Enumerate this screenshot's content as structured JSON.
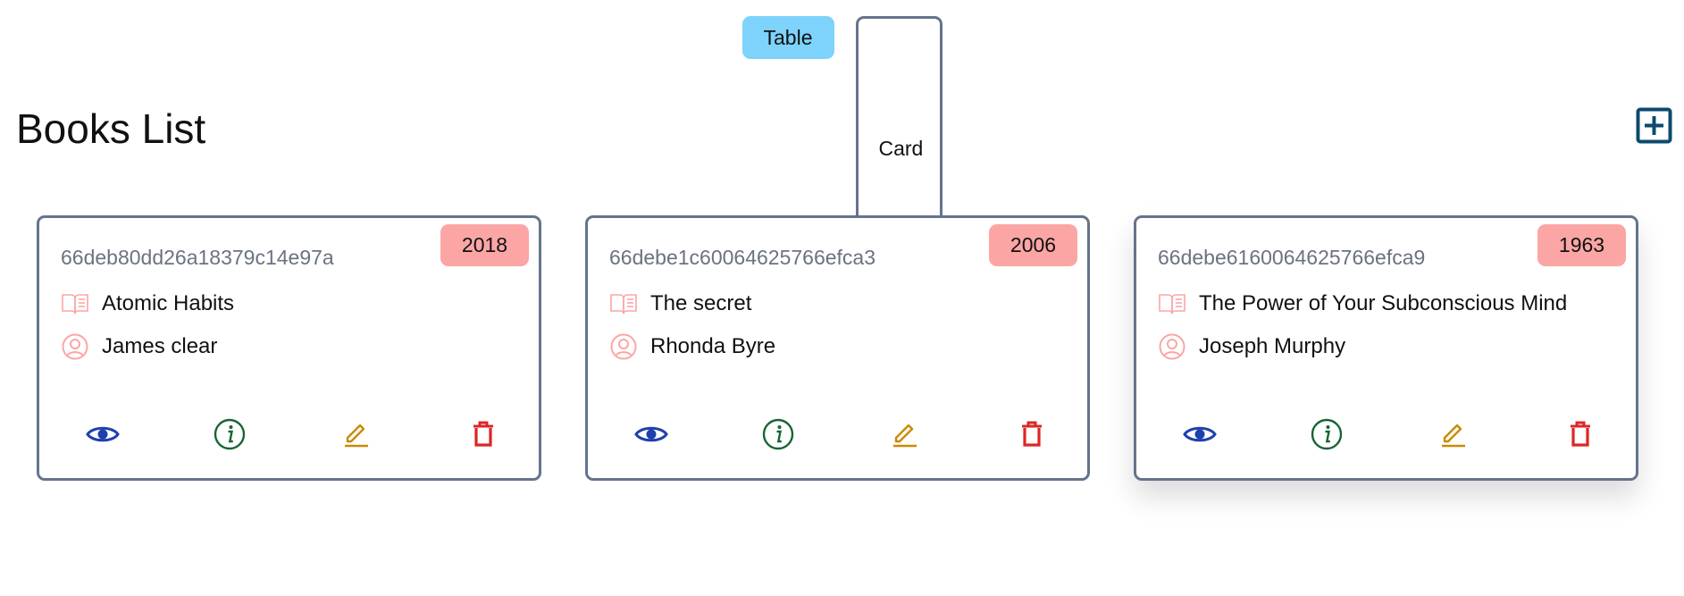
{
  "view_toggle": {
    "table_label": "Table",
    "card_label": "Card"
  },
  "header": {
    "title": "Books List",
    "add_icon": "plus-square-icon"
  },
  "colors": {
    "toggle_bg": "#7dd3fc",
    "badge_bg": "#fca5a5",
    "card_border": "#64748b",
    "icon_accent": "#fca5a5",
    "show_icon": "#1e40af",
    "info_icon": "#166534",
    "edit_icon": "#ca8a04",
    "delete_icon": "#dc2626",
    "add_icon": "#0c4a6e"
  },
  "books": [
    {
      "id": "66deb80dd26a18379c14e97a",
      "year": "2018",
      "title": "Atomic Habits",
      "author": "James clear"
    },
    {
      "id": "66debe1c60064625766efca3",
      "year": "2006",
      "title": "The secret",
      "author": "Rhonda Byre"
    },
    {
      "id": "66debe6160064625766efca9",
      "year": "1963",
      "title": "The Power of Your Subconscious Mind",
      "author": "Joseph Murphy"
    }
  ],
  "card_actions": [
    "eye-icon",
    "info-circle-icon",
    "pencil-icon",
    "trash-icon"
  ]
}
